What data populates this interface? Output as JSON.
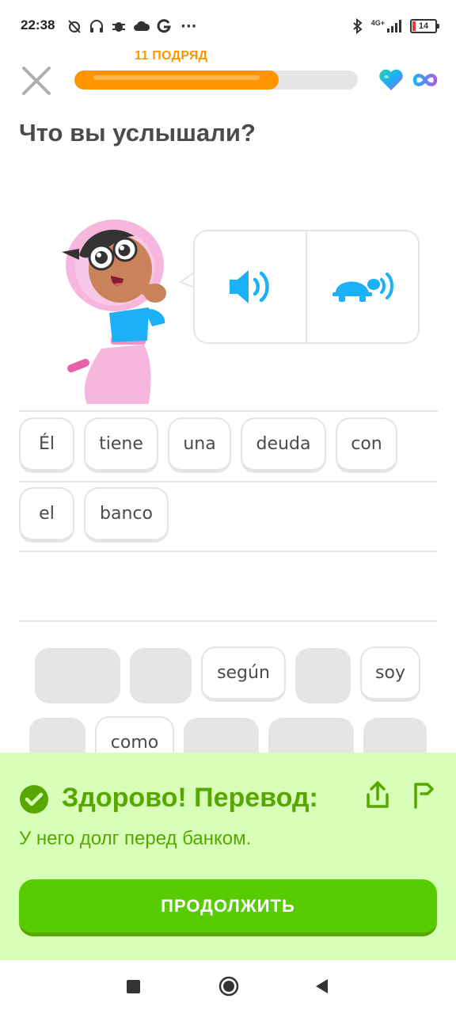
{
  "status_bar": {
    "time": "22:38",
    "more": "···",
    "network": "4G+",
    "battery": "14"
  },
  "header": {
    "streak_label": "11 ПОДРЯД",
    "progress_percent": 72,
    "lives": "infinite"
  },
  "question": {
    "title": "Что вы услышали?"
  },
  "answer_tiles": [
    "Él",
    "tiene",
    "una",
    "deuda",
    "con",
    "el",
    "banco"
  ],
  "word_bank": {
    "visible_words": [
      "según",
      "soy",
      "como"
    ]
  },
  "feedback": {
    "title": "Здорово! Перевод:",
    "translation": "У него долг перед банком.",
    "continue_label": "ПРОДОЛЖИТЬ"
  },
  "colors": {
    "accent_orange": "#ff9600",
    "success_green": "#58cc02",
    "success_text": "#58a700",
    "feedback_bg": "#d7ffb8",
    "audio_blue": "#1cb0f6"
  },
  "icons": {
    "close": "close-icon",
    "heart": "heart-icon",
    "infinity": "infinity-icon",
    "speaker": "speaker-icon",
    "slow_speaker": "turtle-speaker-icon",
    "check": "check-circle-icon",
    "share": "share-icon",
    "report": "flag-icon"
  }
}
